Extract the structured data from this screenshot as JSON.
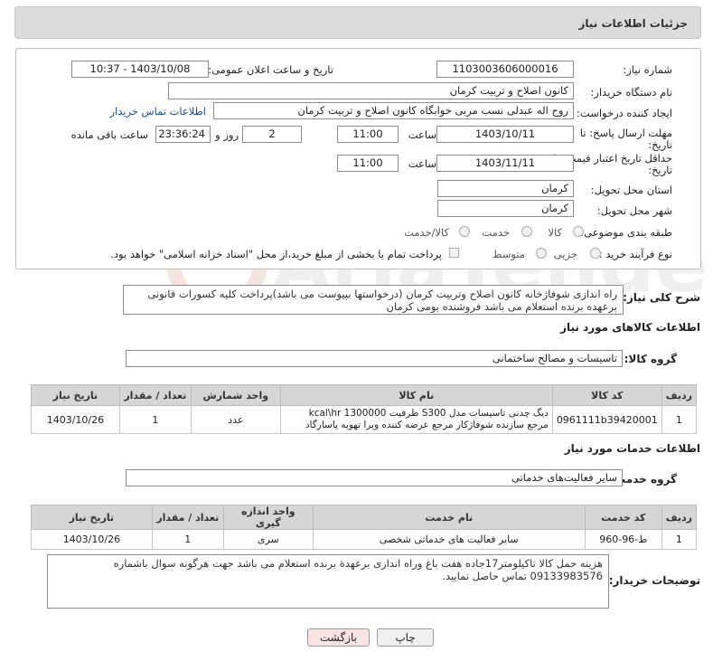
{
  "header": {
    "title": "جزئیات اطلاعات نیاز"
  },
  "form": {
    "need_number_label": "شماره نیاز:",
    "need_number": "1103003606000016",
    "announce_label": "تاریخ و ساعت اعلان عمومی:",
    "announce_value": "1403/10/08 - 10:37",
    "buyer_org_label": "نام دستگاه خریدار:",
    "buyer_org": "کانون اصلاح و تربیت کرمان",
    "creator_label": "ایجاد کننده درخواست:",
    "creator": "روح اله عبدلی نسب مربی خوابگاه کانون اصلاح و تربیت کرمان",
    "contact_link": "اطلاعات تماس خریدار",
    "deadline_label_1": "مهلت ارسال پاسخ: تا",
    "deadline_label_2": "تاریخ:",
    "deadline_date": "1403/10/11",
    "time_label": "ساعت",
    "deadline_time": "11:00",
    "days_value": "2",
    "days_label": "روز و",
    "remaining_time": "23:36:24",
    "remaining_label": "ساعت باقی مانده",
    "validity_label_1": "حداقل تاریخ اعتبار قیمت: تا",
    "validity_label_2": "تاریخ:",
    "validity_date": "1403/11/11",
    "validity_time": "11:00",
    "province_label": "استان محل تحویل:",
    "province": "کرمان",
    "city_label": "شهر محل تحویل:",
    "city": "کرمان",
    "category_label": "طبقه بندی موضوعی:",
    "category_options": [
      "کالا",
      "خدمت",
      "کالا/خدمت"
    ],
    "process_label": "نوع فرآیند خرید :",
    "process_options": [
      "جزیی",
      "متوسط"
    ],
    "payment_note": "پرداخت تمام یا بخشی از مبلغ خرید،از محل \"اسناد خزانه اسلامی\" خواهد بود."
  },
  "description": {
    "label": "شرح کلی نیاز:",
    "text": "راه اندازی شوفاژخانه کانون اصلاح وتربیت کرمان (درخواستها بپیوست می باشد)پرداخت کلیه کسورات قانونی برعهده برنده استعلام می باشد فروشنده بومی کرمان"
  },
  "goods": {
    "title": "اطلاعات کالاهای مورد نیاز",
    "group_label": "گروه کالا:",
    "group_value": "تاسیسات و مصالح ساختمانی",
    "headers": [
      "ردیف",
      "کد کالا",
      "نام کالا",
      "واحد شمارش",
      "تعداد / مقدار",
      "تاریخ نیاز"
    ],
    "rows": [
      {
        "row": "1",
        "code": "0961111b39420001",
        "name": "دیگ چدنی تاسیسات مدل S300 ظرفیت 1300000 kcal\\hr مرجع سازنده شوفاژکار مرجع عرضه کننده ویرا تهویه پاسارگاد",
        "unit": "عدد",
        "qty": "1",
        "date": "1403/10/26"
      }
    ]
  },
  "services": {
    "title": "اطلاعات خدمات مورد نیاز",
    "group_label": "گروه خدمت:",
    "group_value": "سایر فعالیت‌های خدماتی",
    "headers": [
      "ردیف",
      "کد خدمت",
      "نام خدمت",
      "واحد اندازه گیری",
      "تعداد / مقدار",
      "تاریخ نیاز"
    ],
    "rows": [
      {
        "row": "1",
        "code": "ط-96-960",
        "name": "سایر فعالیت های خدماتی شخصی",
        "unit": "سری",
        "qty": "1",
        "date": "1403/10/26"
      }
    ]
  },
  "buyer_notes": {
    "label": "توضیحات خریدار:",
    "text": "هزینه حمل کالا تاکیلومتر17جاده هفت باغ وراه اندازی برعهدة برنده استعلام می باشد جهت هرگونه سوال باشماره 09133983576 تماس حاصل نمایید."
  },
  "buttons": {
    "print": "چاپ",
    "back": "بازگشت"
  },
  "colors": {
    "header_bg": "#dcdcdc",
    "table_header_bg": "#d6d6d6",
    "link": "#1a4e9e",
    "back_button_bg": "#fbe3e3"
  }
}
